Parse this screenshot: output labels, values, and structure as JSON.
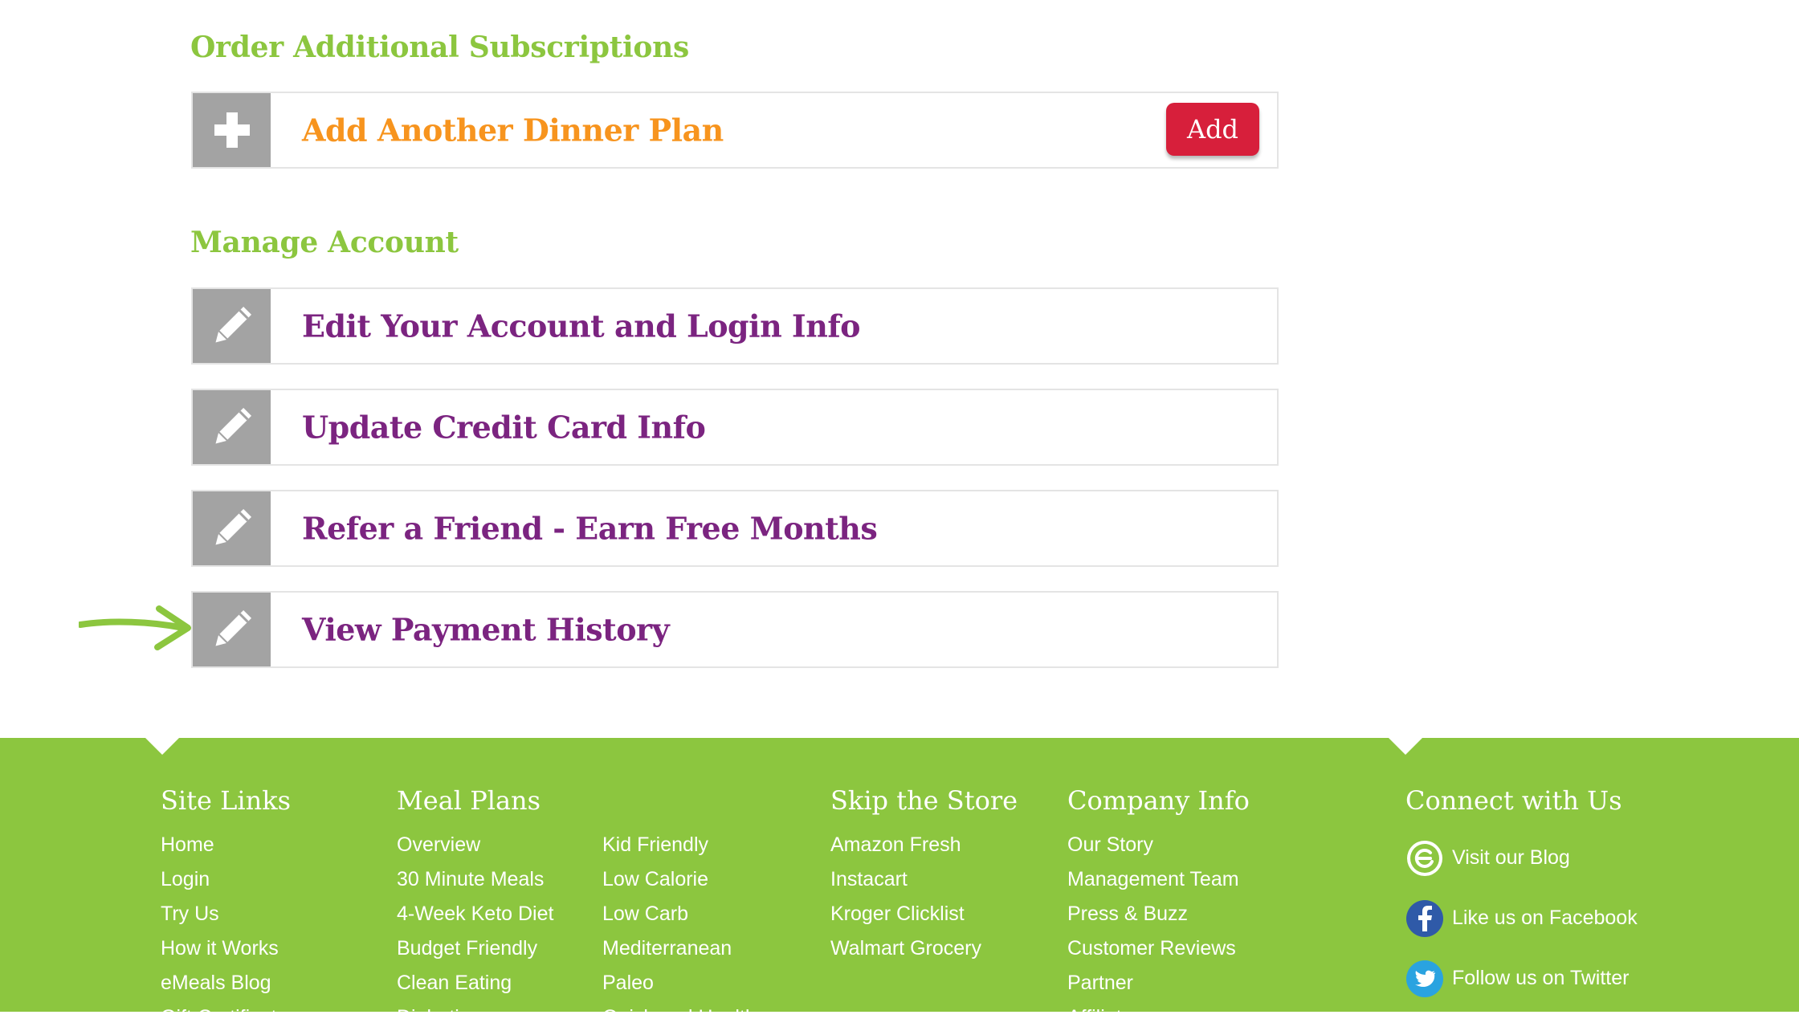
{
  "order_section": {
    "title": "Order Additional Subscriptions",
    "item": {
      "label": "Add Another Dinner Plan",
      "button": "Add"
    }
  },
  "manage_section": {
    "title": "Manage Account",
    "items": [
      {
        "label": "Edit Your Account and Login Info"
      },
      {
        "label": "Update Credit Card Info"
      },
      {
        "label": "Refer a Friend - Earn Free Months"
      },
      {
        "label": "View Payment History"
      }
    ]
  },
  "footer": {
    "site_links": {
      "title": "Site Links",
      "items": [
        "Home",
        "Login",
        "Try Us",
        "How it Works",
        "eMeals Blog",
        "Gift Certificates"
      ]
    },
    "meal_plans": {
      "title": "Meal Plans",
      "col1": [
        "Overview",
        "30 Minute Meals",
        "4-Week Keto Diet",
        "Budget Friendly",
        "Clean Eating",
        "Diabetic"
      ],
      "col2": [
        "Kid Friendly",
        "Low Calorie",
        "Low Carb",
        "Mediterranean",
        "Paleo",
        "Quick and Healthy"
      ]
    },
    "skip_store": {
      "title": "Skip the Store",
      "items": [
        "Amazon Fresh",
        "Instacart",
        "Kroger Clicklist",
        "Walmart Grocery"
      ]
    },
    "company_info": {
      "title": "Company Info",
      "items": [
        "Our Story",
        "Management Team",
        "Press & Buzz",
        "Customer Reviews",
        "Partner",
        "Affiliate"
      ]
    },
    "connect": {
      "title": "Connect with Us",
      "blog": "Visit our Blog",
      "facebook": "Like us on Facebook",
      "twitter": "Follow us on Twitter"
    }
  },
  "colors": {
    "green": "#8cc63f",
    "orange": "#f7941e",
    "purple": "#7b2480",
    "red": "#d71f3b",
    "icon_gray": "#a3a3a3"
  }
}
